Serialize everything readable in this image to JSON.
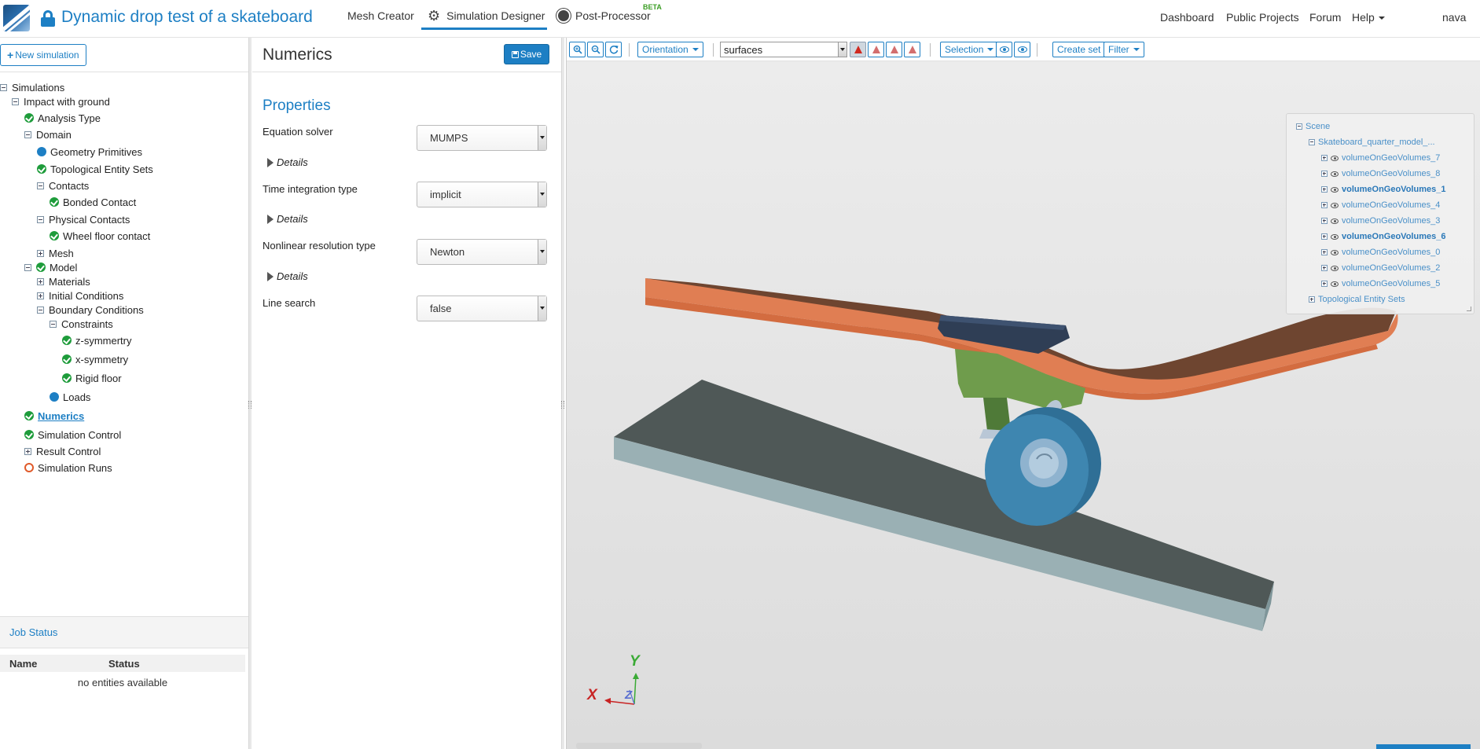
{
  "header": {
    "project_title": "Dynamic drop test of a skateboard",
    "tabs": [
      {
        "label": "Mesh Creator",
        "icon": "grid-icon"
      },
      {
        "label": "Simulation Designer",
        "icon": "gear-icon",
        "active": true
      },
      {
        "label": "Post-Processor",
        "icon": "sun-icon",
        "badge": "BETA"
      }
    ],
    "right_links": [
      "Dashboard",
      "Public Projects",
      "Forum",
      "Help"
    ],
    "user": "nava"
  },
  "sidebar": {
    "new_simulation_label": "New simulation",
    "tree": [
      "Simulations",
      "Impact with ground",
      "Analysis Type",
      "Domain",
      "Geometry Primitives",
      "Topological Entity Sets",
      "Contacts",
      "Bonded Contact",
      "Physical Contacts",
      "Wheel floor contact",
      "Mesh",
      "Model",
      "Materials",
      "Initial Conditions",
      "Boundary Conditions",
      "Constraints",
      "z-symmertry",
      "x-symmetry",
      "Rigid floor",
      "Loads",
      "Numerics",
      "Simulation Control",
      "Result Control",
      "Simulation Runs"
    ]
  },
  "job_status": {
    "title": "Job Status",
    "columns": [
      "Name",
      "Status"
    ],
    "empty_text": "no entities available"
  },
  "numerics": {
    "title": "Numerics",
    "save_label": "Save",
    "properties_heading": "Properties",
    "details_label": "Details",
    "fields": [
      {
        "label": "Equation solver",
        "value": "MUMPS"
      },
      {
        "label": "Time integration type",
        "value": "implicit"
      },
      {
        "label": "Nonlinear resolution type",
        "value": "Newton"
      },
      {
        "label": "Line search",
        "value": "false"
      }
    ]
  },
  "viewer": {
    "toolbar": {
      "orientation_label": "Orientation",
      "render_mode": "surfaces",
      "selection_label": "Selection",
      "create_set_label": "Create set",
      "filter_label": "Filter"
    },
    "scene_tree": {
      "root": "Scene",
      "model": "Skateboard_quarter_model_...",
      "volumes": [
        {
          "name": "volumeOnGeoVolumes_7",
          "bold": false
        },
        {
          "name": "volumeOnGeoVolumes_8",
          "bold": false
        },
        {
          "name": "volumeOnGeoVolumes_1",
          "bold": true
        },
        {
          "name": "volumeOnGeoVolumes_4",
          "bold": false
        },
        {
          "name": "volumeOnGeoVolumes_3",
          "bold": false
        },
        {
          "name": "volumeOnGeoVolumes_6",
          "bold": true
        },
        {
          "name": "volumeOnGeoVolumes_0",
          "bold": false
        },
        {
          "name": "volumeOnGeoVolumes_2",
          "bold": false
        },
        {
          "name": "volumeOnGeoVolumes_5",
          "bold": false
        }
      ],
      "topo_sets": "Topological Entity Sets"
    },
    "axes": {
      "x": "X",
      "y": "Y",
      "z": "Z"
    },
    "colors": {
      "deck": "#e07e53",
      "deck_shadow": "#6e4530",
      "truck": "#6f9c4c",
      "wheel": "#3e86b0",
      "floor_top": "#4f5857",
      "floor_side": "#9ab0b4",
      "accent": "#1d7fc4",
      "ok": "#1e9c3b"
    }
  }
}
